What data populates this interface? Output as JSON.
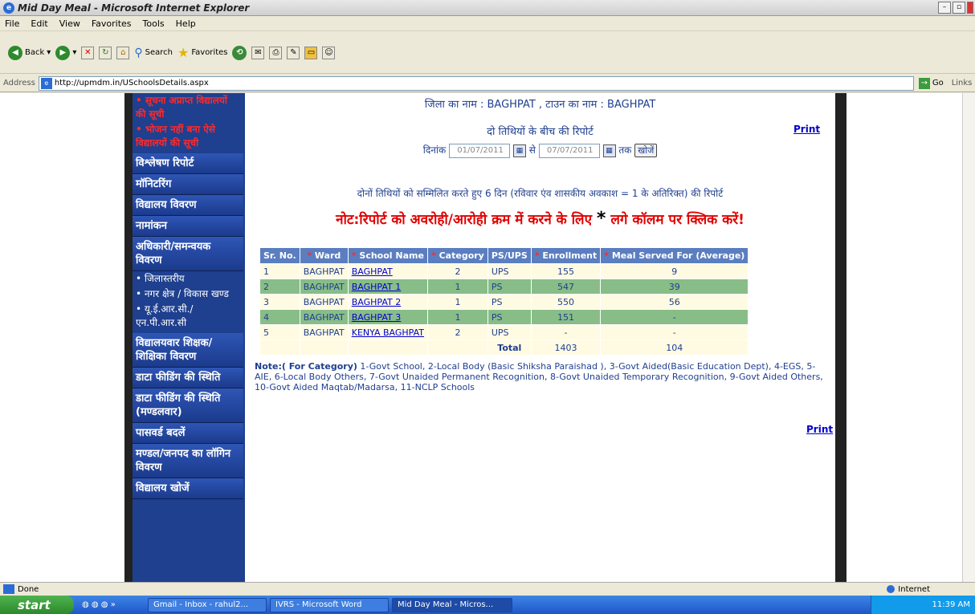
{
  "window": {
    "title": "Mid Day Meal - Microsoft Internet Explorer"
  },
  "menu": [
    "File",
    "Edit",
    "View",
    "Favorites",
    "Tools",
    "Help"
  ],
  "toolbar": {
    "back": "Back",
    "search": "Search",
    "favorites": "Favorites"
  },
  "address": {
    "label": "Address",
    "url": "http://upmdm.in/USchoolsDetails.aspx",
    "go": "Go",
    "links": "Links"
  },
  "sidebar": {
    "red1": "• सूचना अप्राप्त विद्यालयों की सूची",
    "red2": "• भोजन नहीं बना ऐसे विद्यालयों की सूची",
    "items": [
      "विश्लेषण रिपोर्ट",
      "मॉनिटरिंग",
      "विद्यालय विवरण",
      "नामांकन",
      "अधिकारी/समन्वयक विवरण"
    ],
    "subs": [
      "• जिलास्तरीय",
      "• नगर क्षेत्र / विकास खण्ड",
      "• यू.ई.आर.सी./ एन.पी.आर.सी"
    ],
    "items2": [
      "विद्यालयवार शिक्षक/शिक्षिका विवरण",
      "डाटा फीडिंग की स्थिति",
      "डाटा फीडिंग की स्थिति (मण्डलवार)",
      "पासवर्ड बदलें",
      "मण्डल/जनपद का लॉगिन विवरण",
      "विद्यालय खोजें"
    ]
  },
  "content": {
    "heading": "जिला का नाम : BAGHPAT , टाउन का नाम : BAGHPAT",
    "report_title": "दो तिथियों के बीच की रिपोर्ट",
    "print": "Print",
    "date_label": "दिनांक",
    "from_date": "01/07/2011",
    "se": "से",
    "to_date": "07/07/2011",
    "tak": "तक",
    "search_btn": "खोजें",
    "days_note": "दोनों तिथियों को सम्मिलित करते हुए 6 दिन (रविवार एंव शासकीय अवकाश = 1 के अतिरिक्त) की रिपोर्ट",
    "sort_note_a": "नोट:रिपोर्ट को अवरोही/आरोही क्रम में करने के लिए",
    "sort_note_star": "*",
    "sort_note_b": "लगे कॉलम पर क्लिक करें!",
    "category_note_label": "Note:( For Category)",
    "category_note": "1-Govt School, 2-Local Body (Basic Shiksha Paraishad ), 3-Govt Aided(Basic Education Dept), 4-EGS, 5-AIE, 6-Local Body Others, 7-Govt Unaided Permanent Recognition, 8-Govt Unaided Temporary Recognition, 9-Govt Aided Others, 10-Govt Aided Maqtab/Madarsa, 11-NCLP Schools"
  },
  "table": {
    "headers": [
      "Sr. No.",
      "* Ward",
      "* School Name",
      "* Category",
      "PS/UPS",
      "* Enrollment",
      "* Meal Served For (Average)"
    ],
    "rows": [
      [
        "1",
        "BAGHPAT",
        "BAGHPAT",
        "2",
        "UPS",
        "155",
        "9"
      ],
      [
        "2",
        "BAGHPAT",
        "BAGHPAT 1",
        "1",
        "PS",
        "547",
        "39"
      ],
      [
        "3",
        "BAGHPAT",
        "BAGHPAT 2",
        "1",
        "PS",
        "550",
        "56"
      ],
      [
        "4",
        "BAGHPAT",
        "BAGHPAT 3",
        "1",
        "PS",
        "151",
        "-"
      ],
      [
        "5",
        "BAGHPAT",
        "KENYA BAGHPAT",
        "2",
        "UPS",
        "-",
        "-"
      ]
    ],
    "total_label": "Total",
    "total_enrollment": "1403",
    "total_meals": "104"
  },
  "status": {
    "done": "Done",
    "zone": "Internet"
  },
  "taskbar": {
    "start": "start",
    "tasks": [
      "Gmail - Inbox - rahul2...",
      "IVRS - Microsoft Word",
      "Mid Day Meal - Micros..."
    ],
    "time": "11:39 AM"
  }
}
